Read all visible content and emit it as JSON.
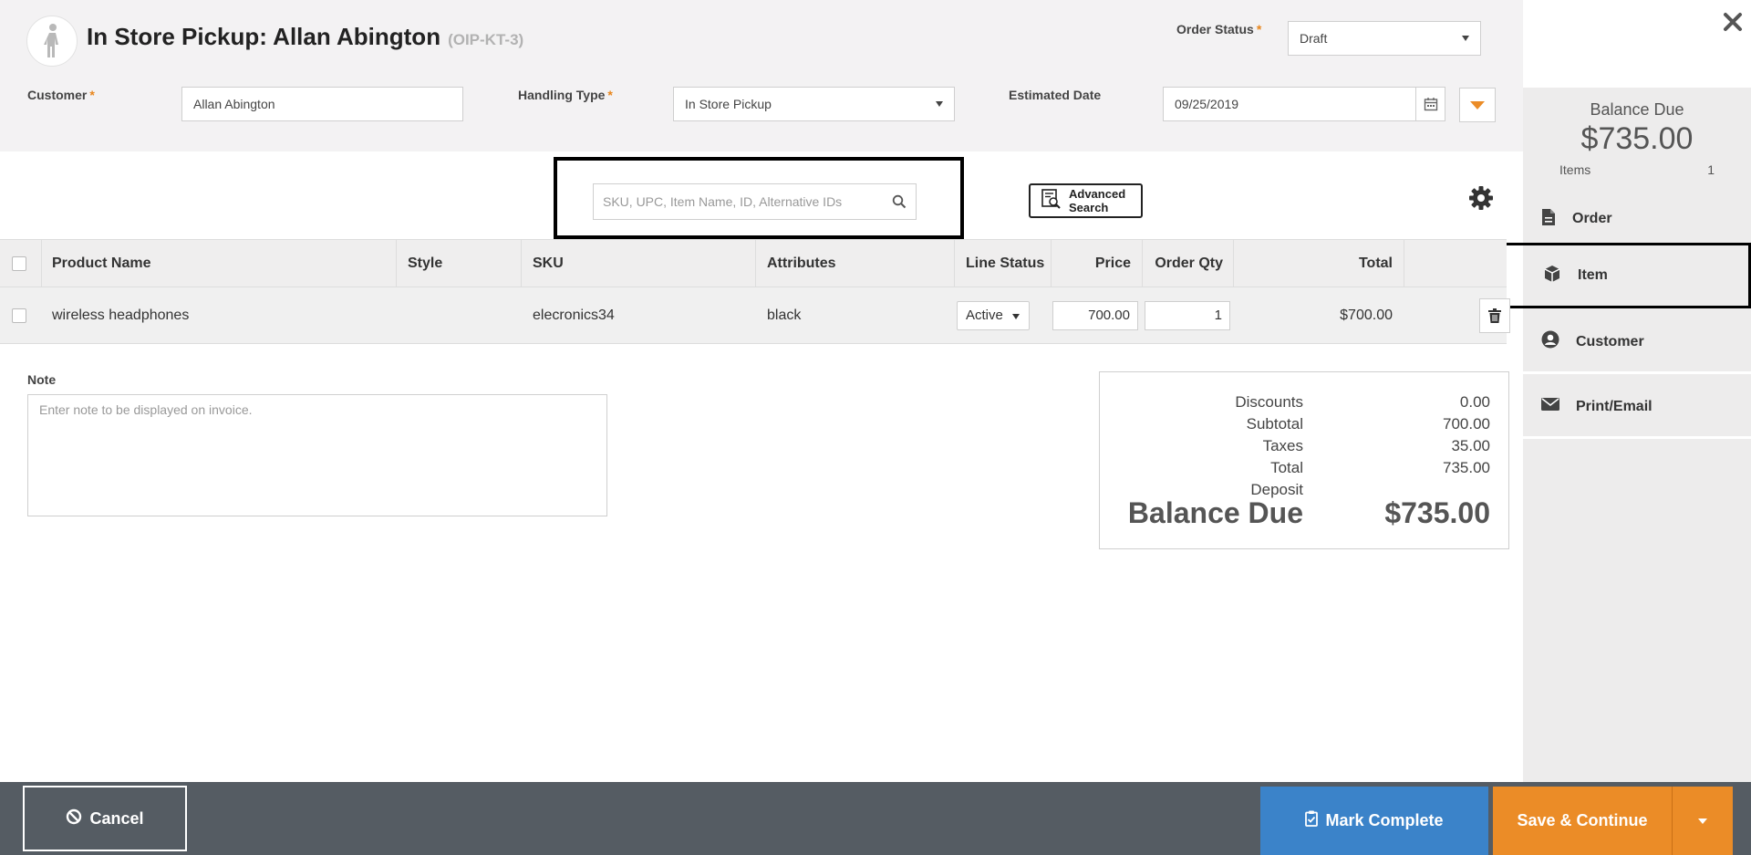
{
  "header": {
    "title": "In Store Pickup: Allan Abington",
    "order_code": "(OIP-KT-3)",
    "order_status_label": "Order Status",
    "order_status_value": "Draft",
    "required_mark": "*",
    "customer_label": "Customer",
    "customer_value": "Allan Abington",
    "handling_label": "Handling Type",
    "handling_value": "In Store Pickup",
    "est_date_label": "Estimated Date",
    "est_date_value": "09/25/2019"
  },
  "side_panel": {
    "balance_label": "Balance Due",
    "balance_amount": "$735.00",
    "items_label": "Items",
    "items_count": "1",
    "nav": [
      {
        "label": "Order",
        "icon": "document-icon"
      },
      {
        "label": "Item",
        "icon": "box-icon"
      },
      {
        "label": "Customer",
        "icon": "user-icon"
      },
      {
        "label": "Print/Email",
        "icon": "envelope-icon"
      }
    ]
  },
  "search": {
    "placeholder": "SKU, UPC, Item Name, ID, Alternative IDs",
    "advanced_line1": "Advanced",
    "advanced_line2": "Search"
  },
  "table": {
    "headers": [
      "Product Name",
      "Style",
      "SKU",
      "Attributes",
      "Line Status",
      "Price",
      "Order Qty",
      "Total"
    ],
    "rows": [
      {
        "product_name": "wireless headphones",
        "style": "",
        "sku": "elecronics34",
        "attributes": "black",
        "line_status": "Active",
        "price": "700.00",
        "order_qty": "1",
        "total": "$700.00"
      }
    ]
  },
  "note": {
    "label": "Note",
    "placeholder": "Enter note to be displayed on invoice."
  },
  "totals": {
    "discounts_label": "Discounts",
    "discounts_value": "0.00",
    "subtotal_label": "Subtotal",
    "subtotal_value": "700.00",
    "taxes_label": "Taxes",
    "taxes_value": "35.00",
    "total_label": "Total",
    "total_value": "735.00",
    "deposit_label": "Deposit",
    "deposit_value": "",
    "balance_label": "Balance Due",
    "balance_value": "$735.00"
  },
  "footer": {
    "cancel_label": "Cancel",
    "complete_label": "Mark Complete",
    "save_label": "Save & Continue"
  },
  "colors": {
    "accent_orange": "#eb8c27",
    "accent_blue": "#3b83c9",
    "footer_bg": "#555c63"
  }
}
